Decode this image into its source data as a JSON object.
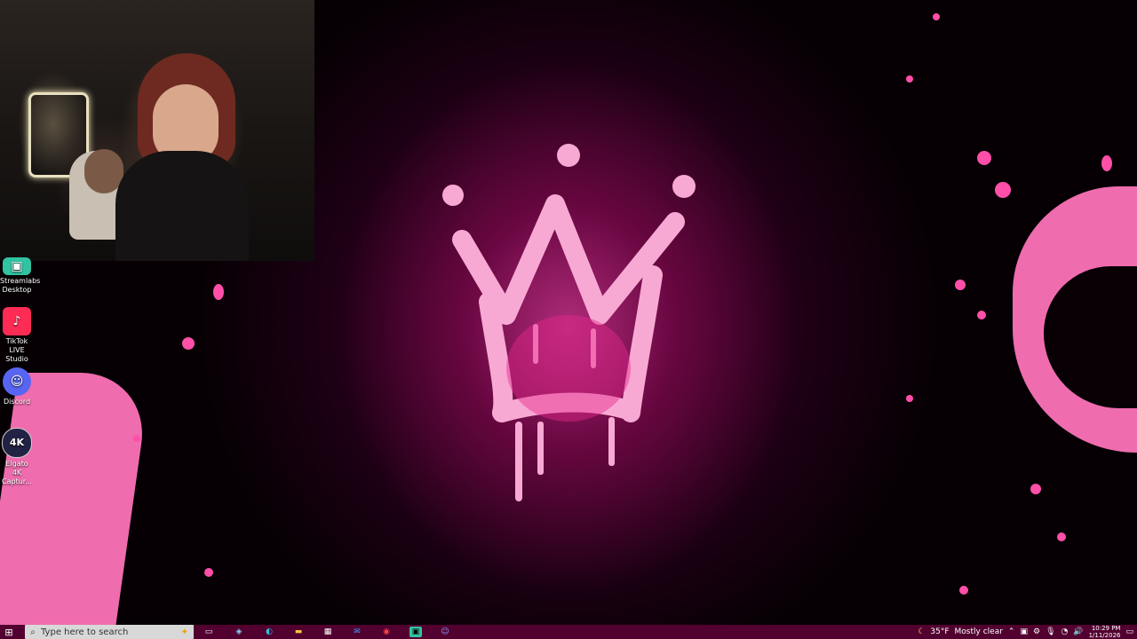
{
  "desktop_icons": [
    {
      "label_line1": "Streamlabs",
      "label_line2": "Desktop",
      "icon": "streamlabs-icon",
      "color": "#31c3a2"
    },
    {
      "label_line1": "TikTok LIVE",
      "label_line2": "Studio",
      "icon": "tiktok-icon",
      "color": "#fe2c55"
    },
    {
      "label_line1": "Discord",
      "label_line2": "",
      "icon": "discord-icon",
      "color": "#5865f2"
    },
    {
      "label_line1": "Elgato 4K",
      "label_line2": "Captur...",
      "icon": "elgato-icon",
      "color": "#222244"
    }
  ],
  "taskbar": {
    "search_placeholder": "Type here to search",
    "pinned_apps": [
      "task-view-icon",
      "copilot-icon",
      "edge-icon",
      "file-explorer-icon",
      "store-icon",
      "outlook-icon",
      "chrome-icon",
      "streamlabs-icon",
      "discord-icon"
    ],
    "weather_temp": "35°F",
    "weather_text": "Mostly clear",
    "time": "10:29 PM",
    "date": "1/11/2026"
  },
  "colors": {
    "accent_pink": "#f26ab0",
    "taskbar": "#520030"
  }
}
